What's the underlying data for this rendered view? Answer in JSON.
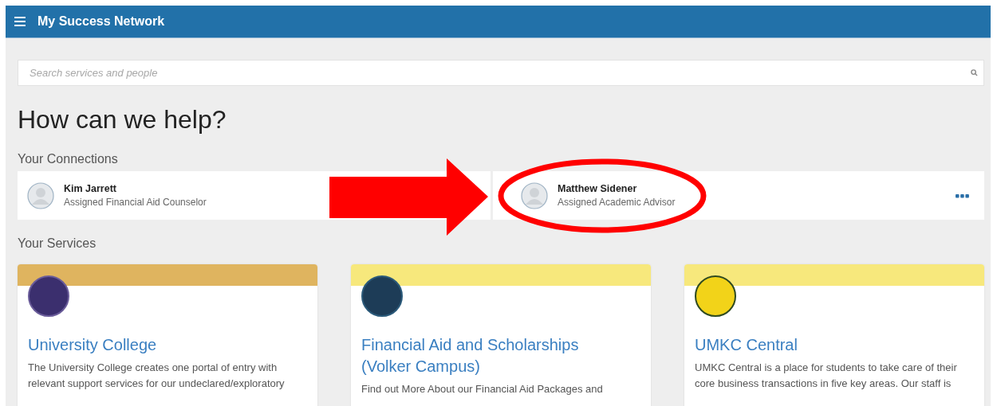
{
  "header": {
    "title": "My Success Network"
  },
  "search": {
    "placeholder": "Search services and people"
  },
  "heading": "How can we help?",
  "connections": {
    "title": "Your Connections",
    "items": [
      {
        "name": "Kim Jarrett",
        "role": "Assigned Financial Aid Counselor",
        "highlighted": false
      },
      {
        "name": "Matthew Sidener",
        "role": "Assigned Academic Advisor",
        "highlighted": true
      }
    ]
  },
  "services": {
    "title": "Your Services",
    "items": [
      {
        "title": "University College",
        "color": "#dfb45f",
        "description": "The University College creates one portal of entry with relevant support services for our undeclared/exploratory"
      },
      {
        "title": "Financial Aid and Scholarships (Volker Campus)",
        "color": "#f7e87c",
        "description": "Find out More About our Financial Aid Packages and"
      },
      {
        "title": "UMKC Central",
        "color": "#f7e87c",
        "description": "UMKC Central is a place for students to take care of their core business transactions in five key areas. Our staff is"
      }
    ]
  }
}
